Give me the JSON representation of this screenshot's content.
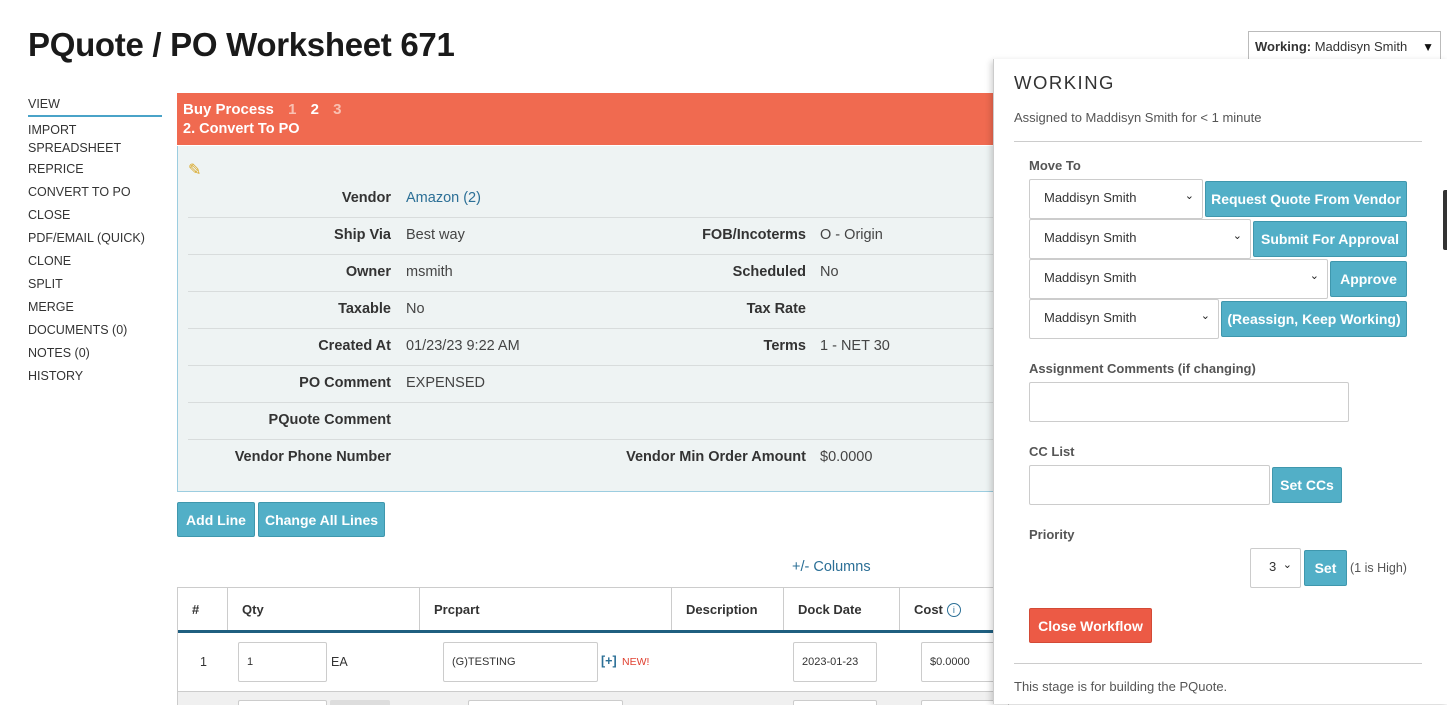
{
  "page": {
    "title": "PQuote / PO Worksheet 671"
  },
  "sidebar": {
    "items": [
      {
        "label": "VIEW"
      },
      {
        "label": "IMPORT SPREADSHEET"
      },
      {
        "label": "REPRICE"
      },
      {
        "label": "CONVERT TO PO"
      },
      {
        "label": "CLOSE"
      },
      {
        "label": "PDF/EMAIL (QUICK)"
      },
      {
        "label": "CLONE"
      },
      {
        "label": "SPLIT"
      },
      {
        "label": "MERGE"
      },
      {
        "label": "DOCUMENTS (0)"
      },
      {
        "label": "NOTES (0)"
      },
      {
        "label": "HISTORY"
      }
    ]
  },
  "process": {
    "label": "Buy Process",
    "steps": [
      "1",
      "2",
      "3"
    ],
    "current_step": "2",
    "stage": "2. Convert To PO",
    "color": "#f06a50"
  },
  "details": {
    "vendor_label": "Vendor",
    "vendor_value": "Amazon (2)",
    "shipvia_label": "Ship Via",
    "shipvia_value": "Best way",
    "fob_label": "FOB/Incoterms",
    "fob_value": "O - Origin",
    "owner_label": "Owner",
    "owner_value": "msmith",
    "scheduled_label": "Scheduled",
    "scheduled_value": "No",
    "taxable_label": "Taxable",
    "taxable_value": "No",
    "taxrate_label": "Tax Rate",
    "created_label": "Created At",
    "created_value": "01/23/23 9:22 AM",
    "terms_label": "Terms",
    "terms_value": "1 - NET 30",
    "pocomment_label": "PO Comment",
    "pocomment_value": "EXPENSED",
    "pqcomment_label": "PQuote Comment",
    "phone_label": "Vendor Phone Number",
    "minorder_label": "Vendor Min Order Amount",
    "minorder_value": "$0.0000"
  },
  "actions": {
    "add_line": "Add Line",
    "change_all": "Change All Lines",
    "columns": "+/- Columns"
  },
  "grid": {
    "headers": [
      "#",
      "Qty",
      "Prcpart",
      "Description",
      "Dock Date",
      "Cost"
    ],
    "rows": [
      {
        "num": "1",
        "qty": "1",
        "uom": "EA",
        "prcpart": "(G)TESTING",
        "plus": "[+]",
        "new": "NEW!",
        "dock_date": "2023-01-23",
        "cost": "$0.0000"
      }
    ]
  },
  "working_dropdown": {
    "label": "Working:",
    "user": "Maddisyn Smith",
    "arrow": "▼"
  },
  "panel": {
    "title": "WORKING",
    "assigned": "Assigned to Maddisyn Smith for < 1 minute",
    "move_to_label": "Move To",
    "move_rows": [
      {
        "select": "Maddisyn Smith",
        "button": "Request Quote From Vendor"
      },
      {
        "select": "Maddisyn Smith",
        "button": "Submit For Approval"
      },
      {
        "select": "Maddisyn Smith",
        "button": "Approve"
      },
      {
        "select": "Maddisyn Smith",
        "button": "(Reassign, Keep Working)"
      }
    ],
    "comments_label": "Assignment Comments (if changing)",
    "cc_label": "CC List",
    "cc_button": "Set CCs",
    "priority_label": "Priority",
    "priority_value": "3",
    "priority_button": "Set",
    "priority_hint": "(1 is High)",
    "close_button": "Close Workflow",
    "footer": "This stage is for building the PQuote."
  }
}
